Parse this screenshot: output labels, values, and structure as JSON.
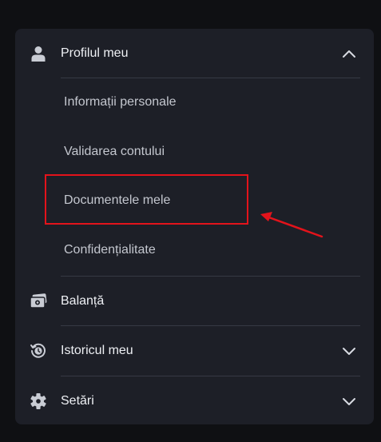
{
  "menu": {
    "profile": {
      "label": "Profilul meu",
      "icon": "person-icon",
      "expanded": true,
      "items": [
        {
          "label": "Informații personale"
        },
        {
          "label": "Validarea contului"
        },
        {
          "label": "Documentele mele"
        },
        {
          "label": "Confidențialitate"
        }
      ]
    },
    "balance": {
      "label": "Balanță",
      "icon": "wallet-icon"
    },
    "history": {
      "label": "Istoricul meu",
      "icon": "history-icon",
      "expanded": false
    },
    "settings": {
      "label": "Setări",
      "icon": "gear-icon",
      "expanded": false
    }
  },
  "annotation": {
    "highlight_color": "#e3131b",
    "highlighted_item": "Documentele mele"
  },
  "colors": {
    "page_bg": "#0f1013",
    "panel_bg": "#1d1f27",
    "divider": "#363944",
    "text_primary": "#eef0f4",
    "text_secondary": "#c4c7cf",
    "icon": "#c9ccd4"
  }
}
